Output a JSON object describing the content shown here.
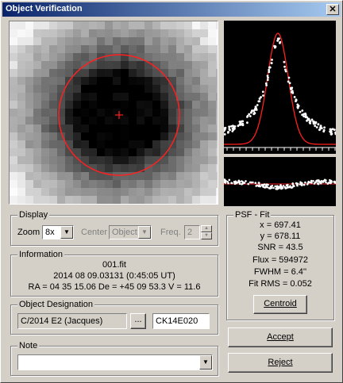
{
  "window": {
    "title": "Object Verification",
    "close_glyph": "✕"
  },
  "display": {
    "group_label": "Display",
    "zoom_label": "Zoom",
    "zoom_value": "8x",
    "center_label": "Center",
    "center_value": "Object",
    "freq_label": "Freq.",
    "freq_value": "2"
  },
  "information": {
    "group_label": "Information",
    "filename": "001.fit",
    "datetime": "2014 08 09.03131 (0:45:05 UT)",
    "coords": "RA = 04 35 15.06   De = +45 09 53.3   V = 11.6"
  },
  "designation": {
    "group_label": "Object Designation",
    "name_value": "C/2014 E2 (Jacques)",
    "ellipsis_label": "...",
    "code_value": "CK14E020"
  },
  "note": {
    "group_label": "Note",
    "value": ""
  },
  "psf_fit": {
    "group_label": "PSF - Fit",
    "x_line": "x = 697.41",
    "y_line": "y = 678.11",
    "snr_line": "SNR = 43.5",
    "flux_line": "Flux = 594972",
    "fwhm_line": "FWHM = 6.4''",
    "rms_line": "Fit RMS = 0.052",
    "centroid_label": "Centroid"
  },
  "buttons": {
    "accept_label": "Accept",
    "reject_label": "Reject"
  },
  "colors": {
    "fit_curve": "#ff2020",
    "data_points": "#ffffff",
    "plot_bg": "#000000",
    "title_start": "#0a246a",
    "title_end": "#a6caf0"
  }
}
